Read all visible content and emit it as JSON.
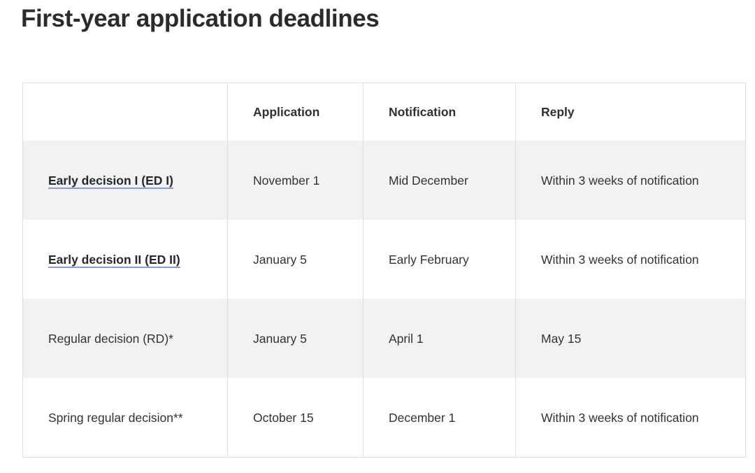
{
  "page": {
    "title": "First-year application deadlines"
  },
  "colors": {
    "title_text": "#2b2b2b",
    "body_text": "#303336",
    "link_text": "#25282b",
    "link_underline": "#8e9ad8",
    "table_border": "#dedede",
    "row_shaded_bg": "#f2f2f2",
    "row_plain_bg": "#ffffff"
  },
  "table": {
    "columns": [
      {
        "key": "type",
        "label": ""
      },
      {
        "key": "application",
        "label": "Application"
      },
      {
        "key": "notification",
        "label": "Notification"
      },
      {
        "key": "reply",
        "label": "Reply"
      }
    ],
    "rows": [
      {
        "type": "Early decision I (ED I)",
        "type_is_link": true,
        "application": "November 1",
        "notification": "Mid December",
        "reply": "Within 3 weeks of notification",
        "shaded": true
      },
      {
        "type": "Early decision II (ED II)",
        "type_is_link": true,
        "application": "January 5",
        "notification": "Early February",
        "reply": "Within 3 weeks of notification",
        "shaded": false
      },
      {
        "type": "Regular decision (RD)*",
        "type_is_link": false,
        "application": "January 5",
        "notification": "April 1",
        "reply": "May 15",
        "shaded": true
      },
      {
        "type": "Spring regular decision**",
        "type_is_link": false,
        "application": "October 15",
        "notification": "December 1",
        "reply": "Within 3 weeks of notification",
        "shaded": false
      }
    ]
  }
}
